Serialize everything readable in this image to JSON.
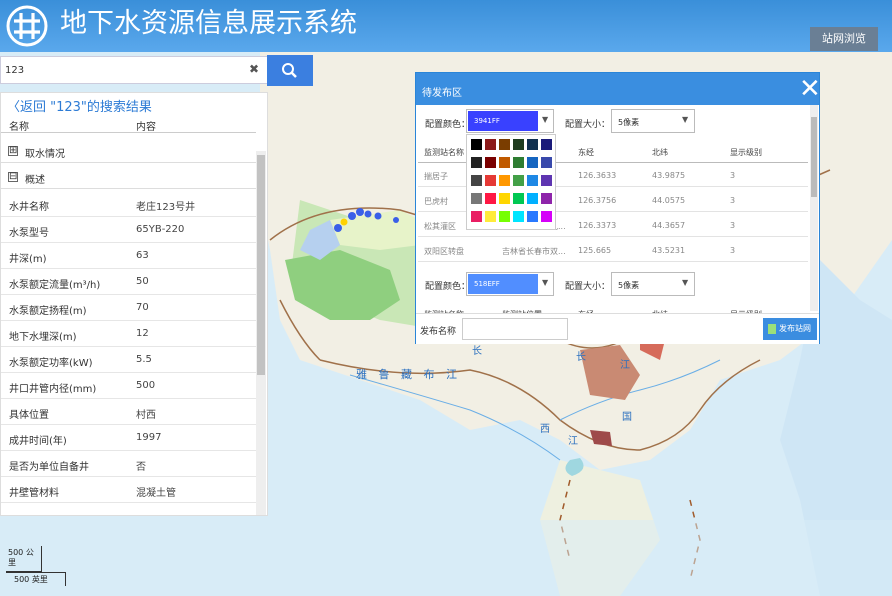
{
  "header": {
    "title": "地下水资源信息展示系统",
    "site_browse": "站网浏览"
  },
  "search": {
    "value": "123"
  },
  "left_panel": {
    "back_label": "〈返回 \"123\"的搜索结果",
    "col_name": "名称",
    "col_content": "内容",
    "groups": [
      {
        "sign": "⊞",
        "label": "取水情况"
      },
      {
        "sign": "⊟",
        "label": "概述"
      }
    ],
    "rows": [
      {
        "k": "水井名称",
        "v": "老庄123号井"
      },
      {
        "k": "水泵型号",
        "v": "65YB-220"
      },
      {
        "k": "井深(m)",
        "v": "63"
      },
      {
        "k": "水泵额定流量(m³/h)",
        "v": "50"
      },
      {
        "k": "水泵额定扬程(m)",
        "v": "70"
      },
      {
        "k": "地下水埋深(m)",
        "v": "12"
      },
      {
        "k": "水泵额定功率(kW)",
        "v": "5.5"
      },
      {
        "k": "井口井管内径(mm)",
        "v": "500"
      },
      {
        "k": "具体位置",
        "v": "村西"
      },
      {
        "k": "成井时间(年)",
        "v": "1997"
      },
      {
        "k": "是否为单位自备井",
        "v": "否"
      },
      {
        "k": "井壁管材料",
        "v": "混凝土管"
      }
    ]
  },
  "dialog": {
    "title": "待发布区",
    "color_label": "配置颜色：",
    "size_label": "配置大小：",
    "color1": "3941FF",
    "color1_hex": "#3941FF",
    "size1": "5像素",
    "color2": "518EFF",
    "color2_hex": "#518EFF",
    "size2": "5像素",
    "headers": [
      "监测站名称",
      "监测站位置",
      "东经",
      "北纬",
      "显示级别"
    ],
    "rows": [
      {
        "name": "揣居子",
        "loc": "",
        "lng": "126.3633",
        "lat": "43.9875",
        "lvl": "3"
      },
      {
        "name": "巴虎村",
        "loc": "",
        "lng": "126.3756",
        "lat": "44.0575",
        "lvl": "3"
      },
      {
        "name": "松其灌区",
        "loc": "吉林省长春市九...",
        "lng": "126.3373",
        "lat": "44.3657",
        "lvl": "3"
      },
      {
        "name": "双阳区转盘",
        "loc": "吉林省长春市双...",
        "lng": "125.665",
        "lat": "43.5231",
        "lvl": "3"
      }
    ],
    "palette": [
      "#000000",
      "#8b1a1a",
      "#7a3d00",
      "#1f3d1f",
      "#10304f",
      "#1a1a7a",
      "#222222",
      "#7a0000",
      "#c05a00",
      "#2e7d32",
      "#1565c0",
      "#3949ab",
      "#444444",
      "#e53935",
      "#ff9800",
      "#43a047",
      "#1e88e5",
      "#5e35b1",
      "#777777",
      "#ff1744",
      "#ffd600",
      "#00c853",
      "#00b0ff",
      "#8e24aa",
      "#e91e63",
      "#ffeb3b",
      "#76ff03",
      "#00e5ff",
      "#2979ff",
      "#d500f9"
    ],
    "publish_name_label": "发布名称",
    "publish_btn": "发布站网"
  },
  "map": {
    "river": "雅 鲁 藏 布 江",
    "scale_km": "500 公里",
    "scale_mi": "500 英里",
    "city_chars": [
      "长",
      "江",
      "西",
      "江",
      "国",
      "长"
    ]
  }
}
